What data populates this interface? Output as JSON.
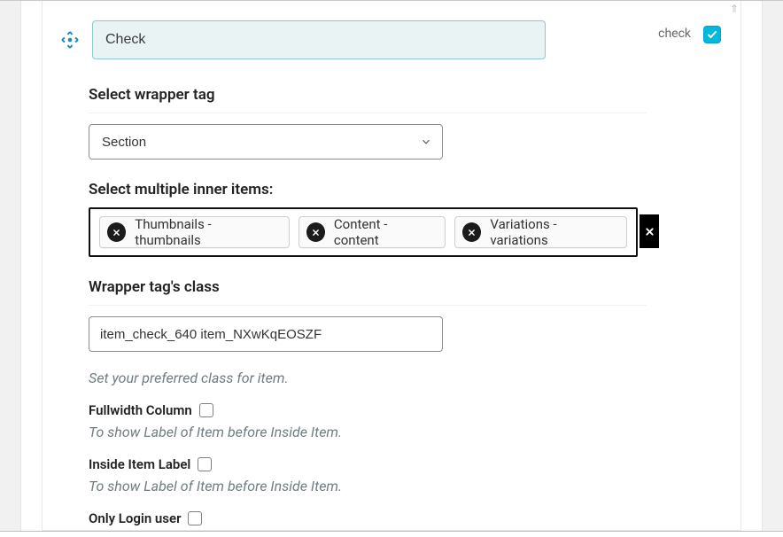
{
  "header": {
    "title_value": "Check",
    "right_label": "check",
    "right_checked": true
  },
  "fields": {
    "wrapper_tag": {
      "label": "Select wrapper tag",
      "selected": "Section"
    },
    "inner_items": {
      "label": "Select multiple inner items:",
      "items": [
        {
          "label": "Thumbnails - thumbnails"
        },
        {
          "label": "Content - content"
        },
        {
          "label": "Variations - variations"
        }
      ]
    },
    "wrapper_class": {
      "label": "Wrapper tag's class",
      "value": "item_check_640 item_NXwKqEOSZF",
      "hint": "Set your preferred class for item."
    },
    "fullwidth_column": {
      "label": "Fullwidth Column",
      "checked": false,
      "hint": "To show Label of Item before Inside Item."
    },
    "inside_item_label": {
      "label": "Inside Item Label",
      "checked": false,
      "hint": "To show Label of Item before Inside Item."
    },
    "only_login_user": {
      "label": "Only Login user",
      "checked": false
    }
  }
}
